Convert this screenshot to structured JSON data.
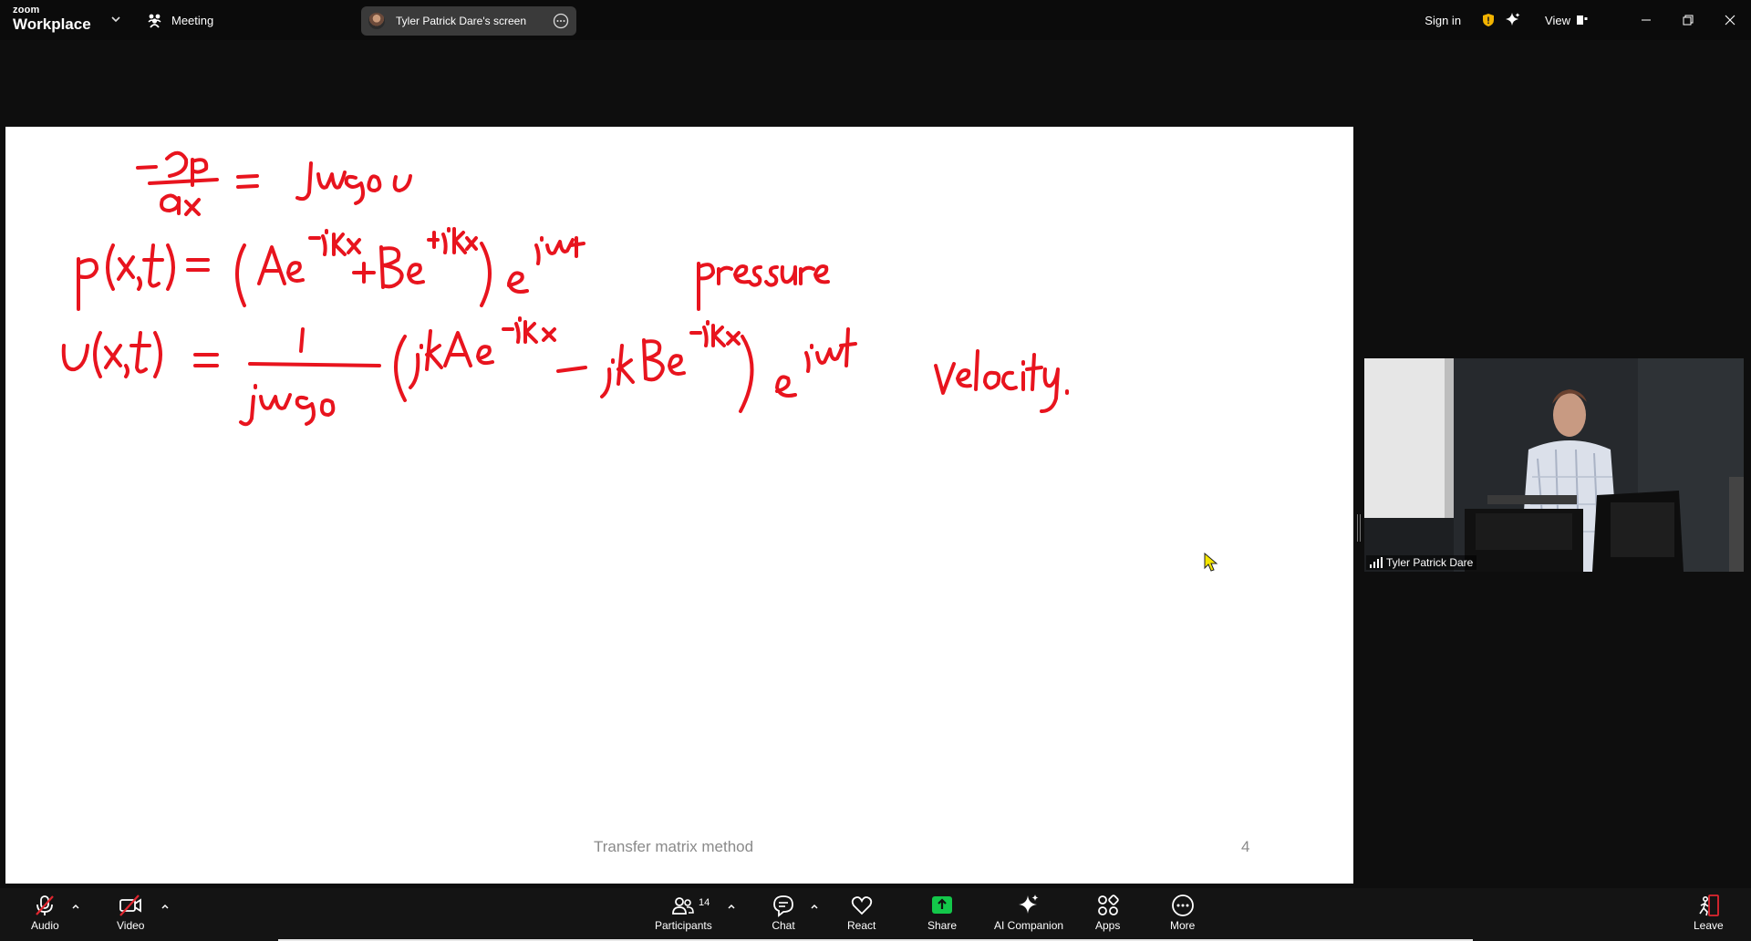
{
  "titlebar": {
    "brand_top": "zoom",
    "brand_bottom": "Workplace",
    "meeting_label": "Meeting",
    "screen_title": "Tyler Patrick Dare's screen",
    "sign_in": "Sign in",
    "view_label": "View"
  },
  "slide": {
    "footer_title": "Transfer matrix method",
    "page_number": "4",
    "annotations": {
      "word_pressure": "pressure",
      "word_velocity": "velocity."
    },
    "ink_color": "#e8141e"
  },
  "video": {
    "participant_name": "Tyler Patrick Dare"
  },
  "toolbar": {
    "audio": "Audio",
    "video": "Video",
    "participants": "Participants",
    "participants_count": "14",
    "chat": "Chat",
    "react": "React",
    "share": "Share",
    "ai_companion": "AI Companion",
    "apps": "Apps",
    "more": "More",
    "leave": "Leave"
  },
  "colors": {
    "share_green": "#13c74a",
    "muted_red": "#e0262f",
    "shield_gold": "#f2b300",
    "leave_red": "#e0262f"
  },
  "icons": {
    "audio": "microphone-muted-icon",
    "video": "camera-off-icon",
    "participants": "people-icon",
    "chat": "chat-bubble-icon",
    "react": "heart-icon",
    "share": "share-screen-icon",
    "ai": "sparkle-icon",
    "apps": "apps-grid-icon",
    "more": "more-dots-icon",
    "leave": "leave-icon"
  }
}
